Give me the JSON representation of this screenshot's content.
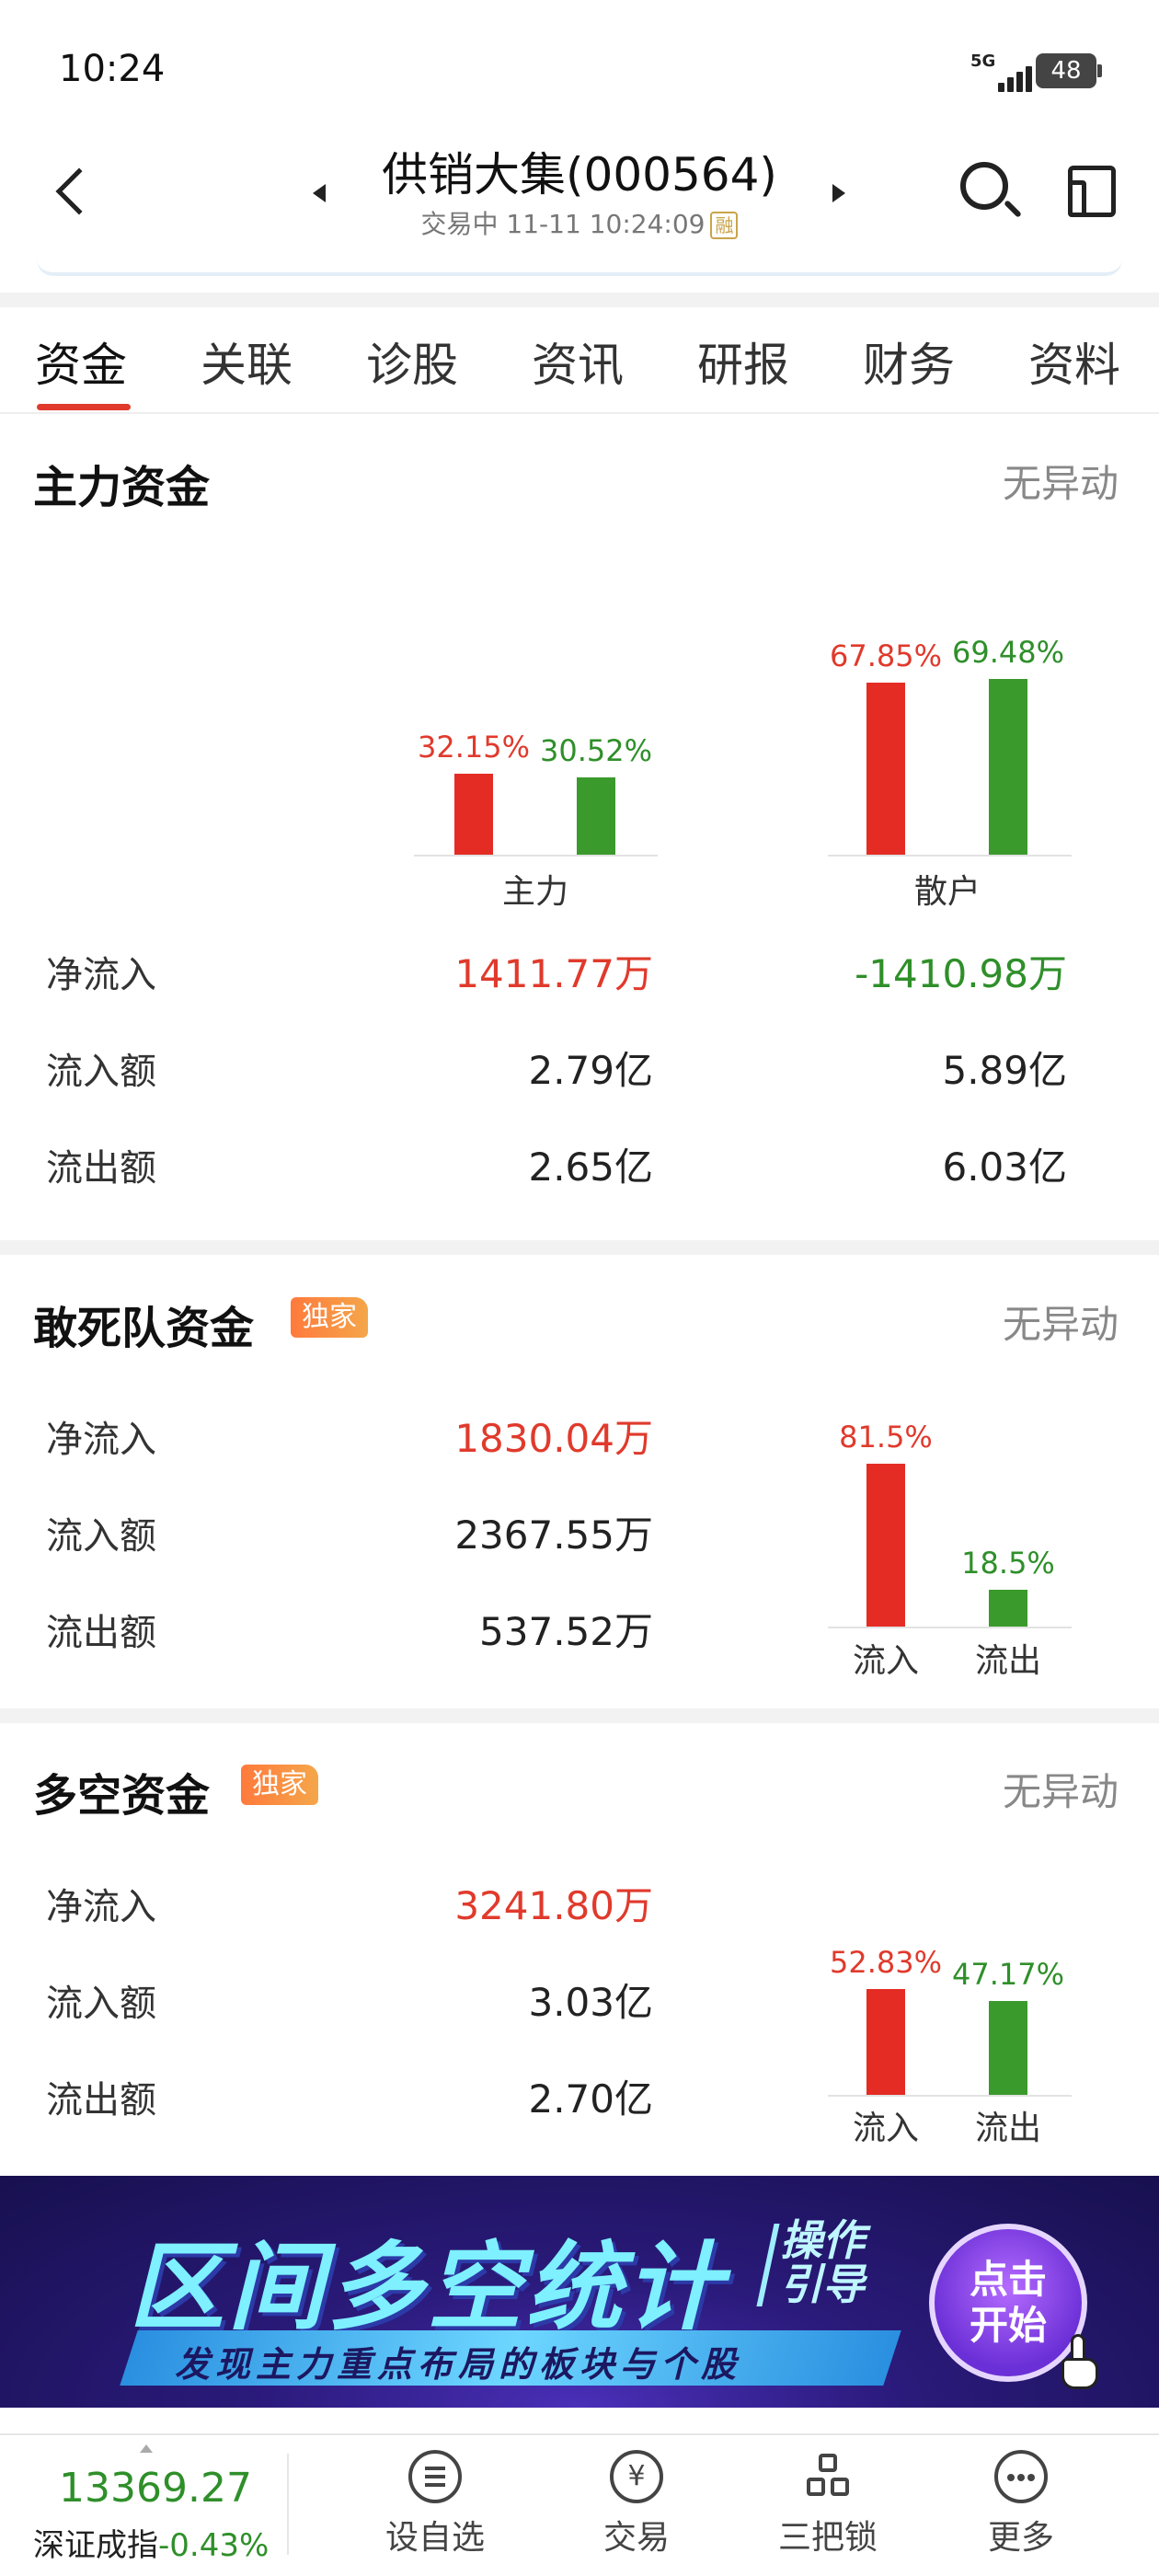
{
  "status_bar": {
    "time": "10:24",
    "network": "5G",
    "battery": "48"
  },
  "header": {
    "title": "供销大集(000564)",
    "subtitle": "交易中 11-11 10:24:09",
    "badge": "融"
  },
  "tabs": [
    "资金",
    "关联",
    "诊股",
    "资讯",
    "研报",
    "财务",
    "资料"
  ],
  "main_fund": {
    "title": "主力资金",
    "status": "无异动",
    "groups": [
      {
        "name": "主力",
        "inflow_pct": 32.15,
        "outflow_pct": 30.52,
        "inflow_pct_label": "32.15%",
        "outflow_pct_label": "30.52%"
      },
      {
        "name": "散户",
        "inflow_pct": 67.85,
        "outflow_pct": 69.48,
        "inflow_pct_label": "67.85%",
        "outflow_pct_label": "69.48%"
      }
    ],
    "rows": [
      {
        "label": "净流入",
        "main": "1411.77万",
        "retail": "-1410.98万"
      },
      {
        "label": "流入额",
        "main": "2.79亿",
        "retail": "5.89亿"
      },
      {
        "label": "流出额",
        "main": "2.65亿",
        "retail": "6.03亿"
      }
    ]
  },
  "dare_fund": {
    "title": "敢死队资金",
    "badge": "独家",
    "status": "无异动",
    "rows": [
      {
        "label": "净流入",
        "value": "1830.04万"
      },
      {
        "label": "流入额",
        "value": "2367.55万"
      },
      {
        "label": "流出额",
        "value": "537.52万"
      }
    ],
    "chart": {
      "in_label": "流入",
      "out_label": "流出",
      "in_pct": 81.5,
      "out_pct": 18.5,
      "in_pct_label": "81.5%",
      "out_pct_label": "18.5%"
    }
  },
  "longshort_fund": {
    "title": "多空资金",
    "badge": "独家",
    "status": "无异动",
    "rows": [
      {
        "label": "净流入",
        "value": "3241.80万"
      },
      {
        "label": "流入额",
        "value": "3.03亿"
      },
      {
        "label": "流出额",
        "value": "2.70亿"
      }
    ],
    "chart": {
      "in_label": "流入",
      "out_label": "流出",
      "in_pct": 52.83,
      "out_pct": 47.17,
      "in_pct_label": "52.83%",
      "out_pct_label": "47.17%"
    }
  },
  "banner": {
    "title": "区间多空统计",
    "tag": "操作引导",
    "subtitle": "发现主力重点布局的板块与个股",
    "button": "点击开始"
  },
  "bottom_bar": {
    "index_value": "13369.27",
    "index_name": "深证成指",
    "index_change": "-0.43%",
    "items": [
      "设自选",
      "交易",
      "三把锁",
      "更多"
    ]
  },
  "colors": {
    "up": "#e03a2c",
    "down": "#2f8f2a",
    "accent": "#e03a2c"
  }
}
